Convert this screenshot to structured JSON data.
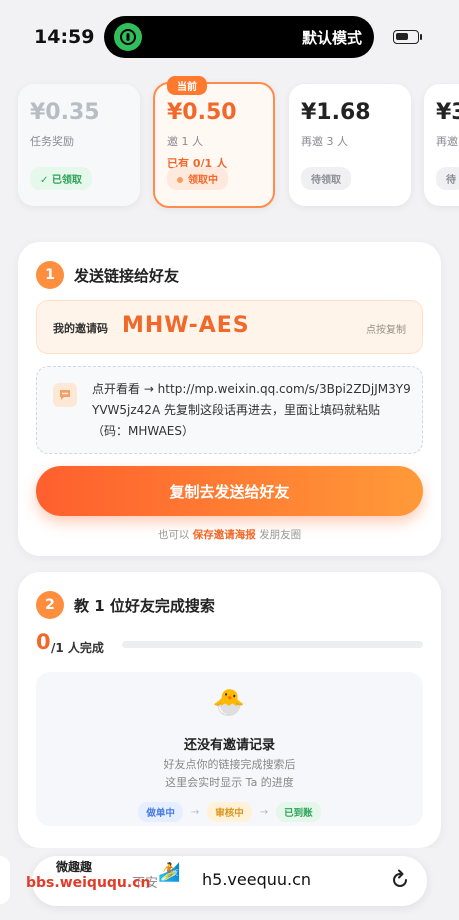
{
  "status_bar": {
    "time": "14:59",
    "island_text": "默认模式"
  },
  "rewards": [
    {
      "amount": "¥0.35",
      "label": "任务奖励",
      "status": "已领取"
    },
    {
      "badge": "当前",
      "amount": "¥0.50",
      "label": "邀 1 人",
      "progress": "已有 0/1 人",
      "status": "领取中"
    },
    {
      "amount": "¥1.68",
      "label": "再邀 3 人",
      "status": "待领取"
    },
    {
      "amount": "¥3",
      "label": "再邀",
      "status": "待"
    }
  ],
  "section1": {
    "number": "1",
    "title": "发送链接给好友",
    "code_label": "我的邀请码",
    "code_value": "MHW-AES",
    "code_copy": "点按复制",
    "message": "点开看看 → http://mp.weixin.qq.com/s/3Bpi2ZDjJM3Y9YVW5jz42A 先复制这段话再进去，里面让填码就粘贴（码：MHWAES）",
    "primary_button": "复制去发送给好友",
    "hint_prefix": "也可以",
    "hint_link": "保存邀请海报",
    "hint_suffix": "发朋友圈"
  },
  "section2": {
    "number": "2",
    "title": "教 1 位好友完成搜索",
    "progress_count": "0",
    "progress_label": "/1 人完成",
    "progress_fraction": 0,
    "empty_title": "还没有邀请记录",
    "empty_desc_1": "好友点你的链接完成搜索后",
    "empty_desc_2": "这里会实时显示 Ta 的进度",
    "steps": [
      "做单中",
      "审核中",
      "已到账"
    ]
  },
  "bottom_bar": {
    "secure_text": "不安",
    "url": "h5.veequu.cn",
    "watermark_top": "微趣趣",
    "watermark": "bbs.weiququ.cn"
  },
  "colors": {
    "accent": "#ff7a2f",
    "accent_text": "#f2682a",
    "success": "#2fa35a"
  },
  "icons": {
    "island": "shield-lock-icon",
    "message": "chat-bubble-icon",
    "empty": "hatching-chick-icon",
    "reload": "reload-icon"
  }
}
